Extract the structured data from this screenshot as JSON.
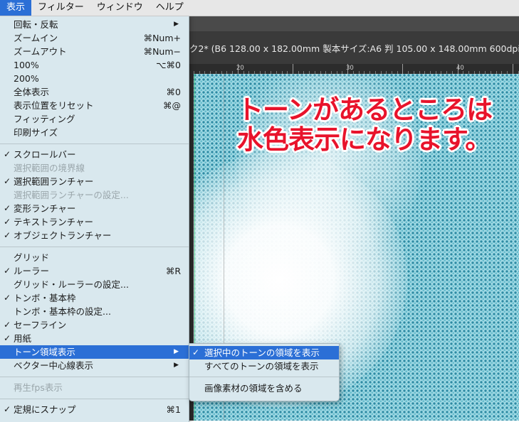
{
  "menubar": {
    "items": [
      {
        "label": "表示",
        "active": true
      },
      {
        "label": "フィルター",
        "active": false
      },
      {
        "label": "ウィンドウ",
        "active": false
      },
      {
        "label": "ヘルプ",
        "active": false
      }
    ]
  },
  "document": {
    "title": "ク2* (B6 128.00 x 182.00mm 製本サイズ:A6 判 105.00 x 148.00mm 600dpi 65"
  },
  "ruler": {
    "labels": [
      "20",
      "30",
      "40"
    ]
  },
  "annotation": {
    "line1": "トーンがあるところは",
    "line2": "水色表示になります。"
  },
  "view_menu": {
    "items": [
      {
        "label": "回転・反転",
        "shortcut": "",
        "checked": false,
        "disabled": false,
        "submenu": true
      },
      {
        "label": "ズームイン",
        "shortcut": "⌘Num+",
        "checked": false,
        "disabled": false
      },
      {
        "label": "ズームアウト",
        "shortcut": "⌘Num−",
        "checked": false,
        "disabled": false
      },
      {
        "label": "100%",
        "shortcut": "⌥⌘0",
        "checked": false,
        "disabled": false
      },
      {
        "label": "200%",
        "shortcut": "",
        "checked": false,
        "disabled": false
      },
      {
        "label": "全体表示",
        "shortcut": "⌘0",
        "checked": false,
        "disabled": false
      },
      {
        "label": "表示位置をリセット",
        "shortcut": "⌘@",
        "checked": false,
        "disabled": false
      },
      {
        "label": "フィッティング",
        "shortcut": "",
        "checked": false,
        "disabled": false
      },
      {
        "label": "印刷サイズ",
        "shortcut": "",
        "checked": false,
        "disabled": false
      },
      {
        "label": "スクロールバー",
        "shortcut": "",
        "checked": true,
        "disabled": false
      },
      {
        "label": "選択範囲の境界線",
        "shortcut": "",
        "checked": false,
        "disabled": true
      },
      {
        "label": "選択範囲ランチャー",
        "shortcut": "",
        "checked": true,
        "disabled": false
      },
      {
        "label": "選択範囲ランチャーの設定...",
        "shortcut": "",
        "checked": false,
        "disabled": true
      },
      {
        "label": "変形ランチャー",
        "shortcut": "",
        "checked": true,
        "disabled": false
      },
      {
        "label": "テキストランチャー",
        "shortcut": "",
        "checked": true,
        "disabled": false
      },
      {
        "label": "オブジェクトランチャー",
        "shortcut": "",
        "checked": true,
        "disabled": false
      },
      {
        "label": "グリッド",
        "shortcut": "",
        "checked": false,
        "disabled": false
      },
      {
        "label": "ルーラー",
        "shortcut": "⌘R",
        "checked": true,
        "disabled": false
      },
      {
        "label": "グリッド・ルーラーの設定...",
        "shortcut": "",
        "checked": false,
        "disabled": false
      },
      {
        "label": "トンボ・基本枠",
        "shortcut": "",
        "checked": true,
        "disabled": false
      },
      {
        "label": "トンボ・基本枠の設定...",
        "shortcut": "",
        "checked": false,
        "disabled": false
      },
      {
        "label": "セーフライン",
        "shortcut": "",
        "checked": true,
        "disabled": false
      },
      {
        "label": "用紙",
        "shortcut": "",
        "checked": true,
        "disabled": false
      },
      {
        "label": "トーン領域表示",
        "shortcut": "",
        "checked": false,
        "disabled": false,
        "submenu": true,
        "highlighted": true
      },
      {
        "label": "ベクター中心線表示",
        "shortcut": "",
        "checked": false,
        "disabled": false,
        "submenu": true
      },
      {
        "label": "再生fps表示",
        "shortcut": "",
        "checked": false,
        "disabled": true
      },
      {
        "label": "定規にスナップ",
        "shortcut": "⌘1",
        "checked": true,
        "disabled": false
      }
    ]
  },
  "tone_submenu": {
    "items": [
      {
        "label": "選択中のトーンの領域を表示",
        "checked": true,
        "highlighted": true
      },
      {
        "label": "すべてのトーンの領域を表示",
        "checked": false
      },
      {
        "label": "画像素材の領域を含める",
        "checked": false
      }
    ]
  },
  "icons": {
    "check": "✓",
    "submenu_arrow": "▶"
  }
}
